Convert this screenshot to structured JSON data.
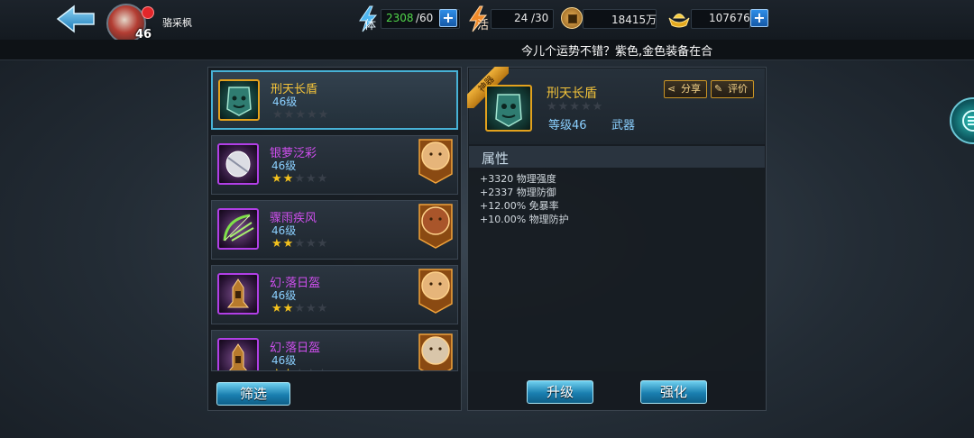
{
  "player": {
    "name": "骆采枫",
    "level": "46"
  },
  "resources": {
    "stamina": {
      "label": "体",
      "value": "2308",
      "max": "/60"
    },
    "energy": {
      "label": "活",
      "value": "24",
      "max": "/30"
    },
    "copper": {
      "value": "18415万"
    },
    "gold": {
      "value": "107676"
    },
    "plus_label": "+"
  },
  "ticker": "今儿个运势不错？紫色,金色装备在合",
  "equipment_list": [
    {
      "name": "刑天长盾",
      "level": "46级",
      "stars": 0,
      "name_color": "#f2c23a",
      "icon": "shield-icon",
      "hero": ""
    },
    {
      "name": "银萝泛彩",
      "level": "46级",
      "stars": 2,
      "name_color": "#cf4fee",
      "icon": "mask-icon",
      "hero": "monk-hero-portrait"
    },
    {
      "name": "骤雨疾风",
      "level": "46级",
      "stars": 2,
      "name_color": "#cf4fee",
      "icon": "bow-icon",
      "hero": "warrior-hero-portrait"
    },
    {
      "name": "幻·落日盔",
      "level": "46级",
      "stars": 2,
      "name_color": "#cf4fee",
      "icon": "helmet-icon",
      "hero": "monk-hero-portrait"
    },
    {
      "name": "幻·落日盔",
      "level": "46级",
      "stars": 2,
      "name_color": "#cf4fee",
      "icon": "helmet-icon",
      "hero": "elder-hero-portrait"
    }
  ],
  "filter_button": "筛选",
  "detail": {
    "tag": "神器",
    "name": "刑天长盾",
    "level_text": "等级46",
    "type": "武器",
    "share": "分享",
    "review": "评价",
    "attributes_title": "属性",
    "attributes": [
      "+3320 物理强度",
      "+2337 物理防御",
      "+12.00% 免暴率",
      "+10.00% 物理防护"
    ],
    "upgrade": "升级",
    "enhance": "强化"
  },
  "colors": {
    "accent": "#47b2d6",
    "gold_name": "#f2c23a",
    "purple_name": "#cf4fee",
    "stamina_value": "#51d64a"
  }
}
